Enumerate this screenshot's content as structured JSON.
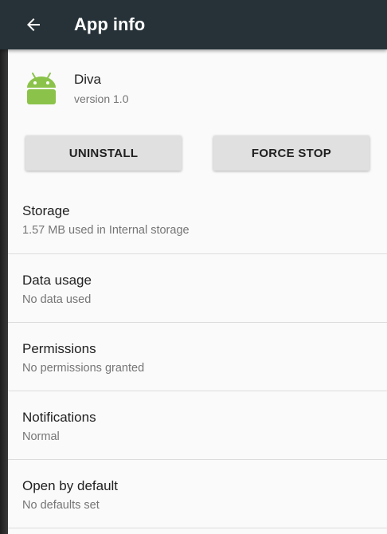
{
  "toolbar": {
    "back_icon": "arrow-back-icon",
    "title": "App info",
    "background": "#263238"
  },
  "app": {
    "icon": "android-icon",
    "icon_color": "#8BC34A",
    "name": "Diva",
    "version": "version 1.0"
  },
  "actions": {
    "uninstall_label": "UNINSTALL",
    "force_stop_label": "FORCE STOP"
  },
  "settings": [
    {
      "title": "Storage",
      "subtitle": "1.57 MB used in Internal storage"
    },
    {
      "title": "Data usage",
      "subtitle": "No data used"
    },
    {
      "title": "Permissions",
      "subtitle": "No permissions granted"
    },
    {
      "title": "Notifications",
      "subtitle": "Normal"
    },
    {
      "title": "Open by default",
      "subtitle": "No defaults set"
    }
  ]
}
